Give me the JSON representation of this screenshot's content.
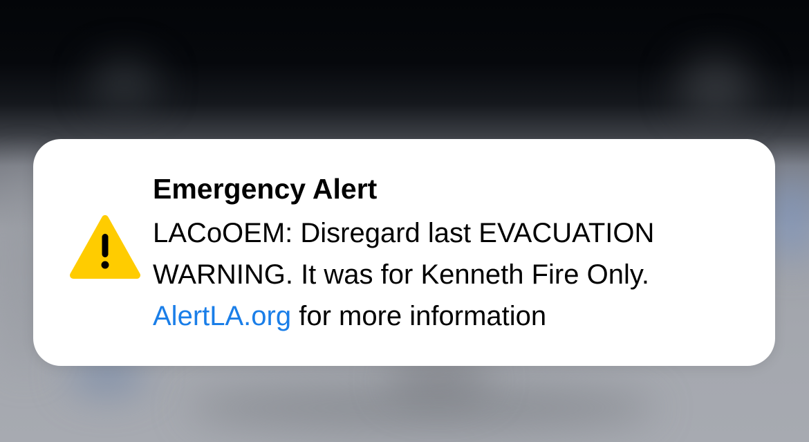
{
  "alert": {
    "icon": "warning-triangle-icon",
    "icon_color": "#FFCC00",
    "title": "Emergency Alert",
    "message_lines": [
      "LACoOEM: Disregard last EVACUATION",
      "WARNING. It was for Kenneth Fire Only."
    ],
    "link_text": "AlertLA.org",
    "link_color": "#1A7EE8",
    "link_suffix": " for more information"
  }
}
